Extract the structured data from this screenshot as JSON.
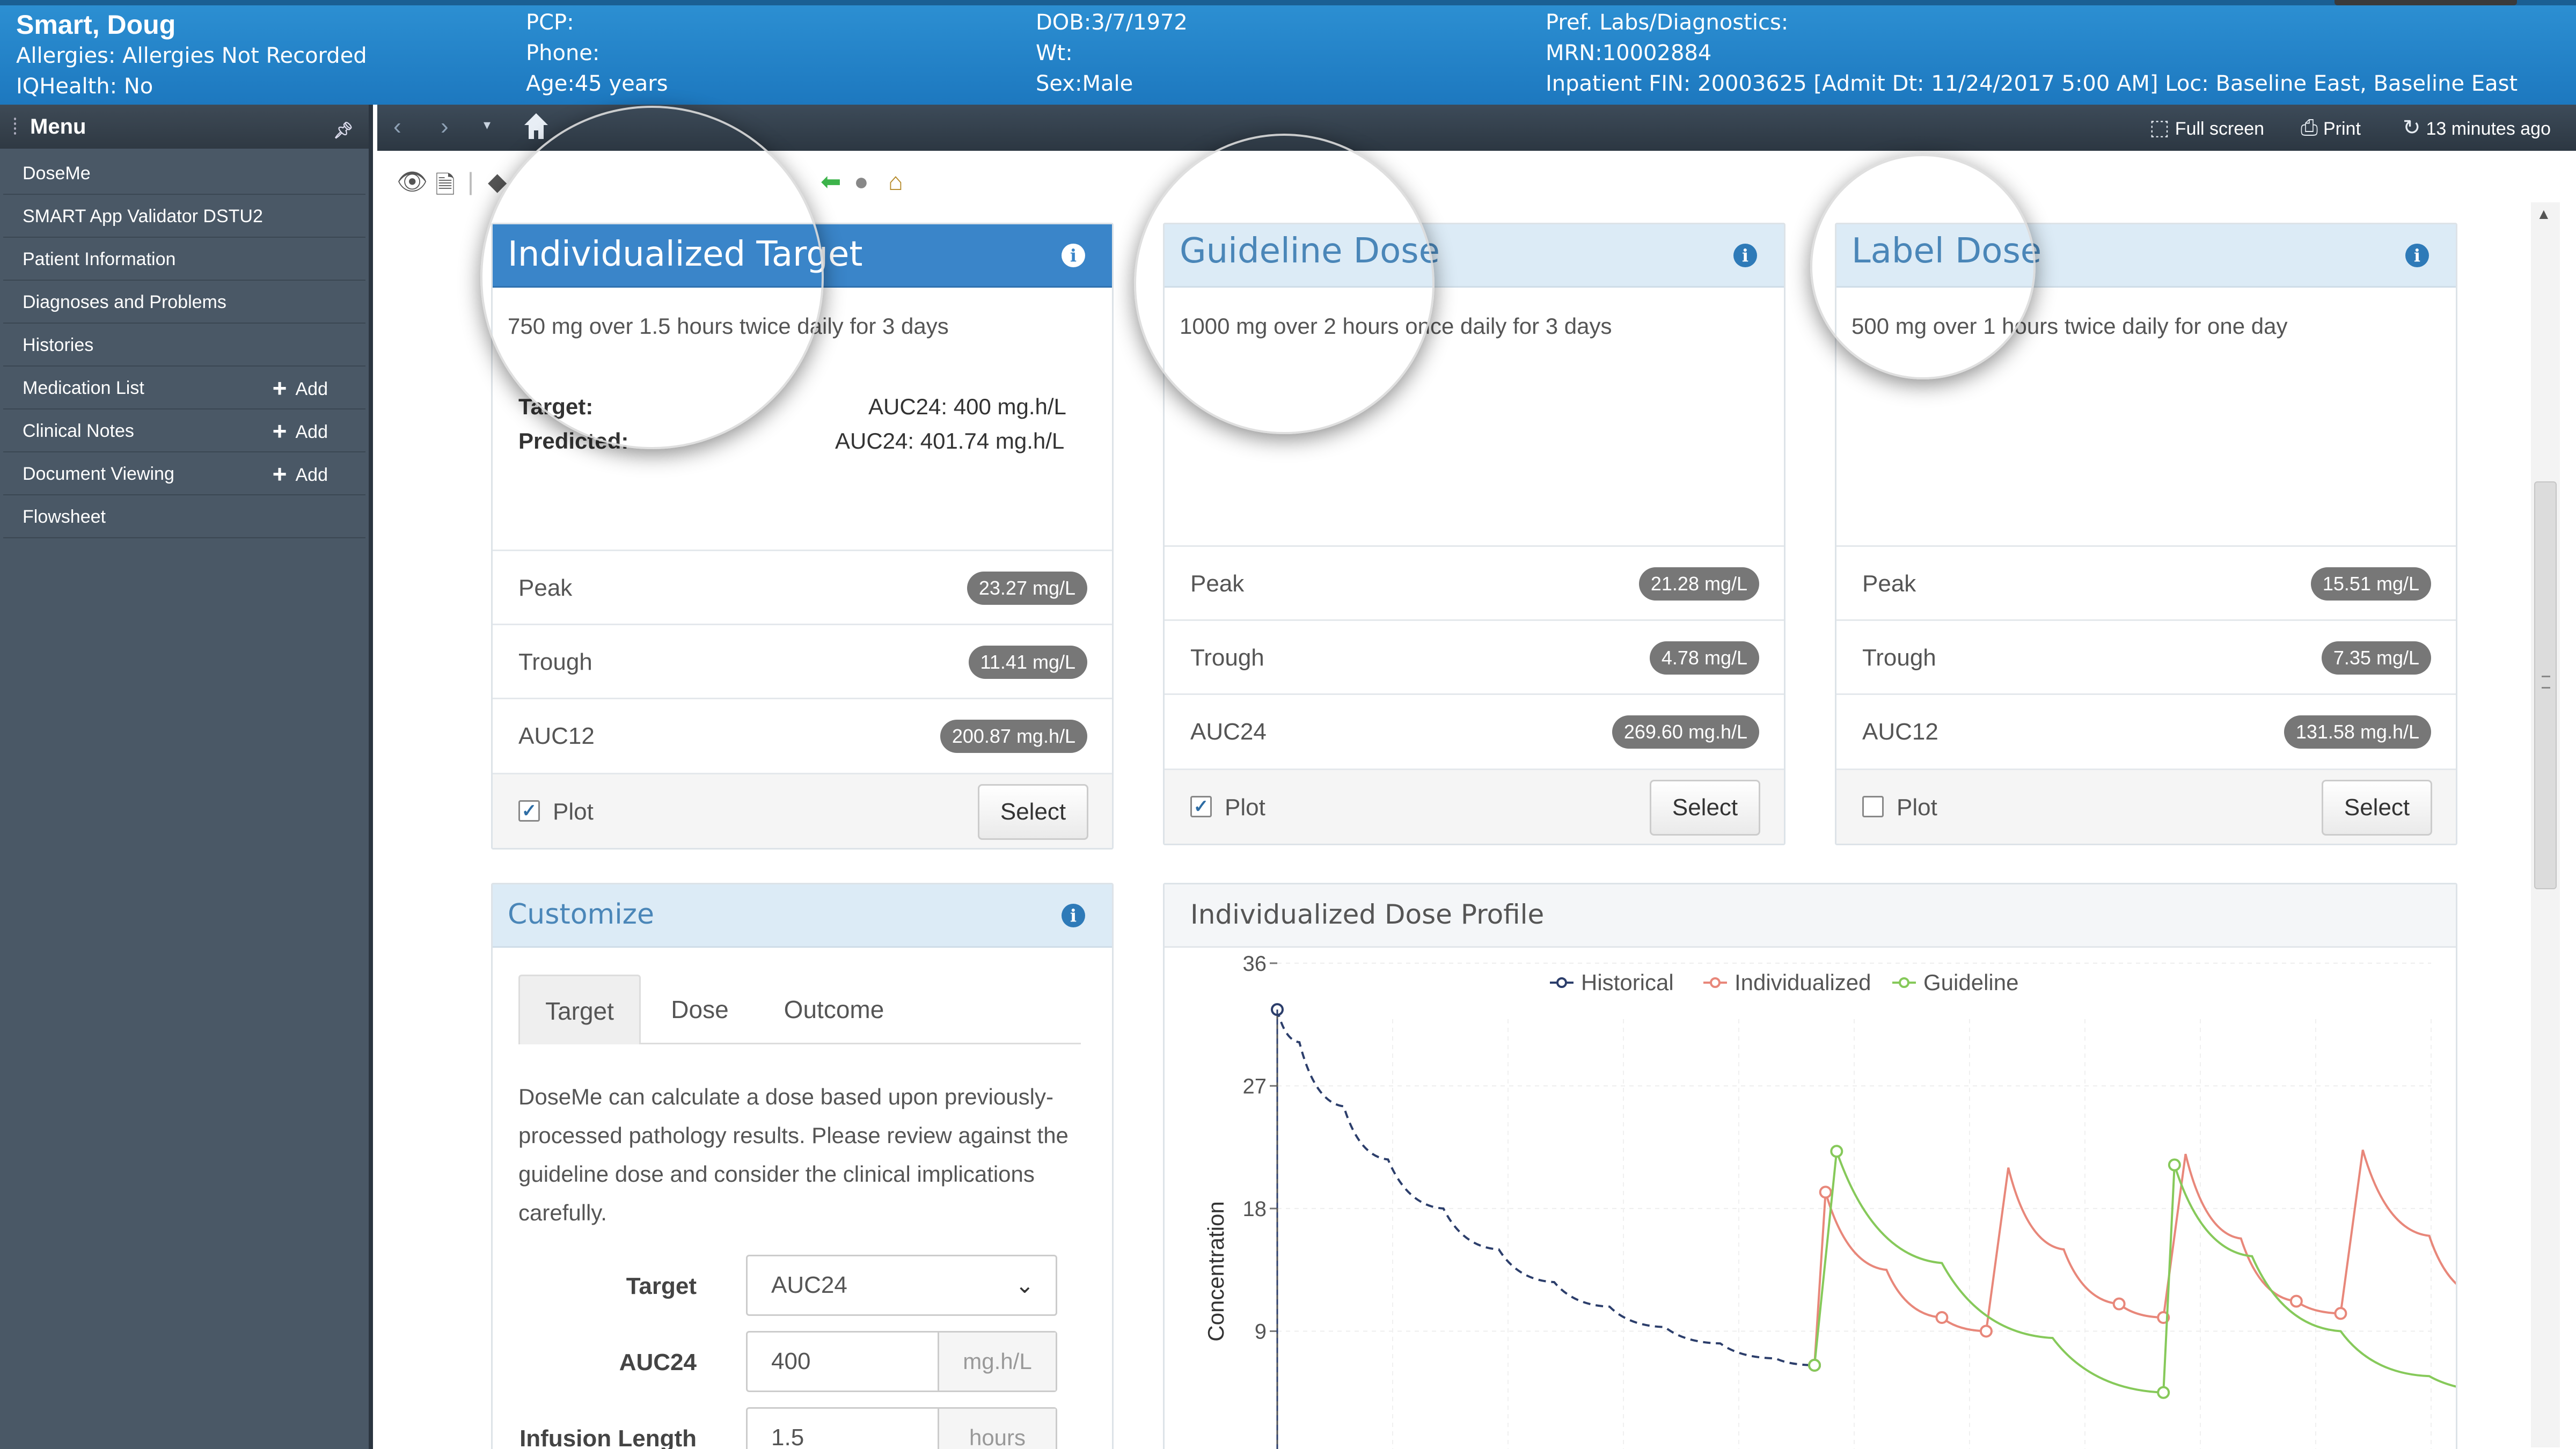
{
  "banner": {
    "patient_name": "Smart, Doug",
    "allergies": "Allergies: Allergies Not Recorded",
    "iqhealth": "IQHealth: No",
    "pcp": "PCP:",
    "phone": "Phone:",
    "age": "Age:45 years",
    "dob": "DOB:3/7/1972",
    "wt": "Wt:",
    "sex": "Sex:Male",
    "pref_labs": "Pref. Labs/Diagnostics:",
    "mrn": "MRN:10002884",
    "inpatient": "Inpatient  FIN: 20003625 [Admit Dt: 11/24/2017 5:00 AM] Loc: Baseline East, Baseline East"
  },
  "menu": {
    "title": "Menu",
    "items": [
      {
        "label": "DoseMe"
      },
      {
        "label": "SMART App Validator DSTU2"
      },
      {
        "label": "Patient Information"
      },
      {
        "label": "Diagnoses and Problems"
      },
      {
        "label": "Histories"
      },
      {
        "label": "Medication List",
        "add": "Add"
      },
      {
        "label": "Clinical Notes",
        "add": "Add"
      },
      {
        "label": "Document Viewing",
        "add": "Add"
      },
      {
        "label": "Flowsheet"
      }
    ]
  },
  "toolbar": {
    "fullscreen": "Full screen",
    "print": "Print",
    "refresh": "13 minutes ago"
  },
  "cards": [
    {
      "title": "Individualized Target",
      "dose_text": "750 mg over 1.5 hours twice daily for 3 days",
      "target_label": "Target:",
      "target_value": "AUC24: 400 mg.h/L",
      "predicted_label": "Predicted:",
      "predicted_value": "AUC24: 401.74 mg.h/L",
      "rows": [
        {
          "label": "Peak",
          "value": "23.27 mg/L"
        },
        {
          "label": "Trough",
          "value": "11.41 mg/L"
        },
        {
          "label": "AUC12",
          "value": "200.87 mg.h/L"
        }
      ],
      "plot_label": "Plot",
      "plot_checked": true,
      "select_label": "Select"
    },
    {
      "title": "Guideline Dose",
      "dose_text": "1000 mg over 2 hours once daily for 3 days",
      "rows": [
        {
          "label": "Peak",
          "value": "21.28 mg/L"
        },
        {
          "label": "Trough",
          "value": "4.78 mg/L"
        },
        {
          "label": "AUC24",
          "value": "269.60 mg.h/L"
        }
      ],
      "plot_label": "Plot",
      "plot_checked": true,
      "select_label": "Select"
    },
    {
      "title": "Label Dose",
      "dose_text": "500 mg over 1 hours twice daily for one day",
      "rows": [
        {
          "label": "Peak",
          "value": "15.51 mg/L"
        },
        {
          "label": "Trough",
          "value": "7.35 mg/L"
        },
        {
          "label": "AUC12",
          "value": "131.58 mg.h/L"
        }
      ],
      "plot_label": "Plot",
      "plot_checked": false,
      "select_label": "Select"
    }
  ],
  "customize": {
    "title": "Customize",
    "tabs": [
      "Target",
      "Dose",
      "Outcome"
    ],
    "description": "DoseMe can calculate a dose based upon previously-processed pathology results. Please review against the guideline dose and consider the clinical implications carefully.",
    "target_label": "Target",
    "target_value": "AUC24",
    "auc_label": "AUC24",
    "auc_value": "400",
    "auc_unit": "mg.h/L",
    "infusion_label": "Infusion Length",
    "infusion_value": "1.5",
    "infusion_unit": "hours"
  },
  "chart": {
    "title": "Individualized Dose Profile"
  },
  "colors": {
    "historical": "#2c3e6b",
    "individualized": "#e8877a",
    "guideline": "#86c95a"
  },
  "chart_data": {
    "type": "line",
    "ylabel": "Concentration",
    "yticks": [
      9,
      18,
      27,
      36
    ],
    "ylim": [
      0,
      37
    ],
    "xlim": [
      0,
      100
    ],
    "legend": [
      "Historical",
      "Individualized",
      "Guideline"
    ],
    "legend_position": "top-center",
    "series": [
      {
        "name": "Historical",
        "style": "dashed",
        "x": [
          0,
          2,
          6,
          10,
          15,
          20,
          25,
          30,
          35,
          40,
          45,
          48.5
        ],
        "y": [
          32.6,
          30.2,
          25.5,
          21.6,
          18.0,
          15.0,
          12.6,
          10.8,
          9.3,
          8.1,
          7.0,
          6.5
        ]
      },
      {
        "name": "Individualized",
        "style": "solid",
        "x": [
          48.5,
          49.5,
          55,
          60,
          64,
          66,
          71,
          76,
          80,
          82,
          87,
          92,
          96,
          98,
          104,
          109,
          113,
          115,
          122,
          129,
          136
        ],
        "y": [
          6.5,
          19.2,
          13.5,
          10.0,
          9.0,
          21.0,
          15.0,
          11.0,
          10.0,
          22.0,
          15.8,
          11.2,
          10.3,
          22.3,
          16.0,
          11.5,
          10.4,
          22.4,
          15.0,
          9.0,
          4.0
        ]
      },
      {
        "name": "Guideline",
        "style": "solid",
        "x": [
          48.5,
          50.5,
          60,
          70,
          80,
          81,
          88,
          96,
          104,
          111,
          112,
          120,
          128,
          136
        ],
        "y": [
          6.5,
          22.2,
          14.0,
          8.5,
          4.5,
          21.2,
          14.5,
          9.0,
          5.7,
          4.5,
          20.8,
          13.0,
          8.0,
          5.0
        ]
      }
    ]
  }
}
